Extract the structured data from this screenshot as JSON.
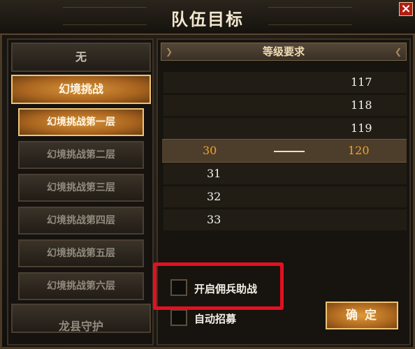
{
  "window": {
    "title": "队伍目标",
    "close_glyph": "×"
  },
  "left_menu": {
    "items": [
      {
        "label": "无",
        "state": "normal"
      },
      {
        "label": "幻境挑战",
        "state": "active"
      },
      {
        "label": "幻境挑战第一层",
        "state": "active"
      },
      {
        "label": "幻境挑战第二层",
        "state": "dim"
      },
      {
        "label": "幻境挑战第三层",
        "state": "dim"
      },
      {
        "label": "幻境挑战第四层",
        "state": "dim"
      },
      {
        "label": "幻境挑战第五层",
        "state": "dim"
      },
      {
        "label": "幻境挑战第六层",
        "state": "dim"
      },
      {
        "label": "龙县守护",
        "state": "dim"
      }
    ]
  },
  "level_panel": {
    "header": "等级要求",
    "max_levels": [
      "117",
      "118",
      "119",
      "120",
      "",
      "",
      ""
    ],
    "min_levels": [
      "",
      "",
      "",
      "30",
      "31",
      "32",
      "33"
    ],
    "selected": {
      "min": "30",
      "max": "120"
    }
  },
  "options": {
    "mercenary_label": "开启佣兵助战",
    "mercenary_checked": false,
    "auto_recruit_label": "自动招募",
    "auto_recruit_checked": false
  },
  "confirm_label": "确定",
  "colors": {
    "accent_orange": "#f5a321",
    "highlight_red": "#e31020",
    "button_gold": "#d9953a"
  }
}
